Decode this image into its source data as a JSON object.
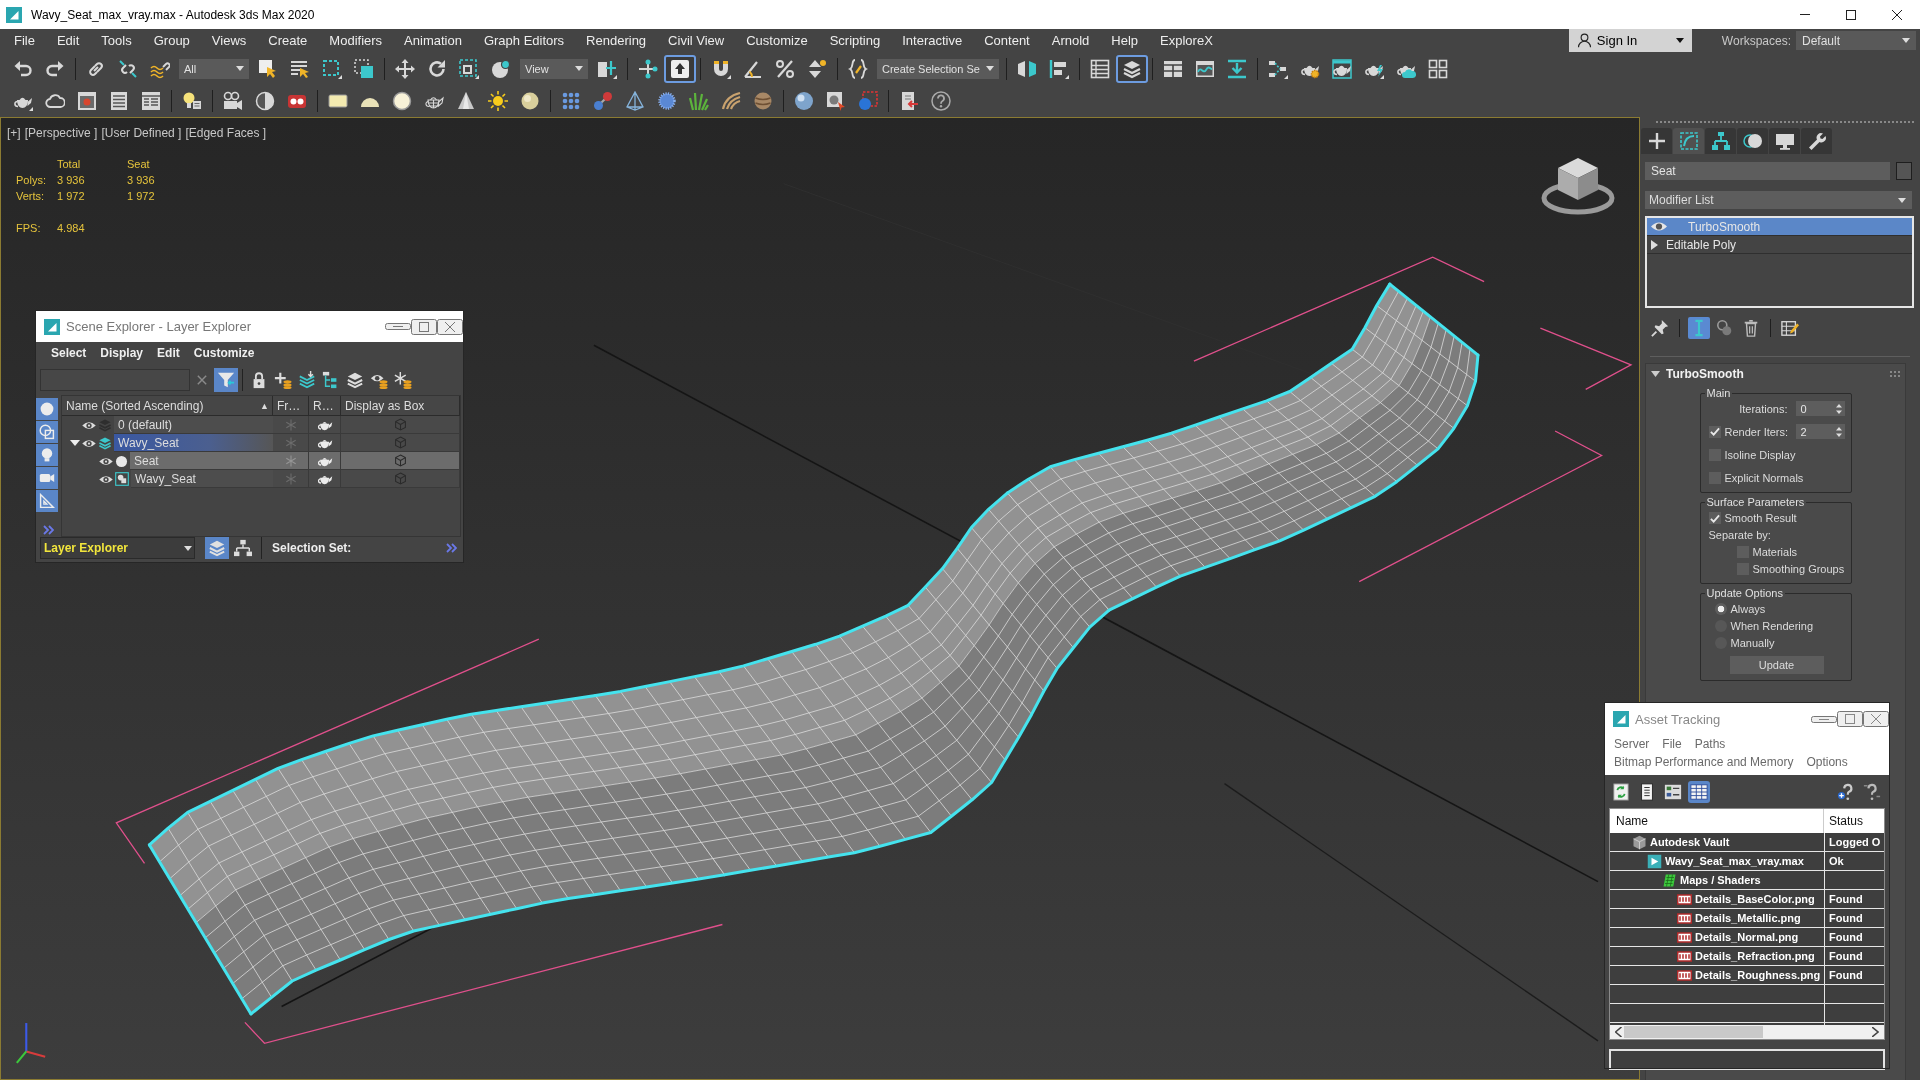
{
  "window": {
    "title": "Wavy_Seat_max_vray.max - Autodesk 3ds Max 2020"
  },
  "menu_bar": {
    "items": [
      "File",
      "Edit",
      "Tools",
      "Group",
      "Views",
      "Create",
      "Modifiers",
      "Animation",
      "Graph Editors",
      "Rendering",
      "Civil View",
      "Customize",
      "Scripting",
      "Interactive",
      "Content",
      "Arnold",
      "Help",
      "ExploreX"
    ],
    "sign_in": "Sign In",
    "workspaces_label": "Workspaces:",
    "workspace": "Default"
  },
  "main_toolbar": {
    "groups": [
      [
        {
          "kind": "button",
          "selected": false
        },
        {
          "kind": "button",
          "selected": false
        }
      ],
      [
        {
          "kind": "button",
          "selected": false
        },
        {
          "kind": "button",
          "selected": false
        },
        {
          "kind": "button",
          "selected": false
        },
        {
          "kind": "dropdown",
          "value": "All"
        },
        {
          "kind": "button",
          "selected": false
        },
        {
          "kind": "button",
          "selected": false
        },
        {
          "kind": "button",
          "selected": false
        },
        {
          "kind": "button",
          "selected": false
        }
      ],
      [
        {
          "kind": "button",
          "selected": false
        },
        {
          "kind": "button",
          "selected": false
        },
        {
          "kind": "button",
          "selected": false
        },
        {
          "kind": "button",
          "selected": false
        },
        {
          "kind": "dropdown",
          "value": "View"
        },
        {
          "kind": "button",
          "selected": false
        }
      ],
      [
        {
          "kind": "button",
          "selected": false
        },
        {
          "kind": "button",
          "selected": true
        }
      ],
      [
        {
          "kind": "button",
          "selected": false
        },
        {
          "kind": "button",
          "selected": false
        },
        {
          "kind": "button",
          "selected": false
        },
        {
          "kind": "button",
          "selected": false
        }
      ],
      [
        {
          "kind": "button",
          "selected": false
        },
        {
          "kind": "dropdown",
          "value": "Create Selection Se"
        }
      ],
      [
        {
          "kind": "button",
          "selected": false
        },
        {
          "kind": "button",
          "selected": false
        }
      ],
      [
        {
          "kind": "button",
          "selected": false
        },
        {
          "kind": "button",
          "selected": true
        }
      ],
      [
        {
          "kind": "button",
          "selected": false
        },
        {
          "kind": "button",
          "selected": false
        },
        {
          "kind": "button",
          "selected": false
        }
      ],
      [
        {
          "kind": "button",
          "selected": false
        },
        {
          "kind": "button",
          "selected": false
        },
        {
          "kind": "button",
          "selected": false
        },
        {
          "kind": "button",
          "selected": false
        },
        {
          "kind": "button",
          "selected": false
        },
        {
          "kind": "button",
          "selected": false
        }
      ]
    ]
  },
  "viewport": {
    "labels": [
      "[+]",
      "[Perspective ]",
      "[User Defined ]",
      "[Edged Faces ]"
    ],
    "stats": {
      "columns": [
        "Total",
        "Seat"
      ],
      "rows": [
        {
          "label": "Polys:",
          "values": [
            "3 936",
            "3 936"
          ]
        },
        {
          "label": "Verts:",
          "values": [
            "1 972",
            "1 972"
          ]
        }
      ],
      "fps": {
        "label": "FPS:",
        "value": "4.984"
      }
    }
  },
  "scene_explorer": {
    "title": "Scene Explorer - Layer Explorer",
    "menu": [
      "Select",
      "Display",
      "Edit",
      "Customize"
    ],
    "tools": [
      {
        "selected": false
      },
      {
        "selected": true
      },
      {
        "selected": false
      },
      {
        "selected": false
      },
      {
        "selected": false
      },
      {
        "selected": false
      },
      {
        "selected": false
      },
      {
        "selected": false
      },
      {
        "selected": false
      }
    ],
    "filters": [
      {
        "selected": true
      },
      {
        "selected": true
      },
      {
        "selected": true
      },
      {
        "selected": true
      },
      {
        "selected": true
      }
    ],
    "columns": [
      {
        "label": "Name (Sorted Ascending)",
        "sort": "▲"
      },
      {
        "label": "Fr…"
      },
      {
        "label": "R…"
      },
      {
        "label": "Display as Box"
      }
    ],
    "tree": [
      {
        "name": "0 (default)",
        "kind": "layer",
        "current": false,
        "selected": false,
        "highlighted": false
      },
      {
        "name": "Wavy_Seat",
        "kind": "layer",
        "current": true,
        "selected": true,
        "highlighted": false,
        "expanded": true,
        "children": [
          {
            "name": "Seat",
            "kind": "object",
            "selected": false,
            "highlighted": true
          },
          {
            "name": "Wavy_Seat",
            "kind": "group",
            "selected": false,
            "highlighted": false
          }
        ]
      }
    ],
    "explorer": "Layer Explorer",
    "modes": [
      {
        "selected": true
      },
      {
        "selected": false
      }
    ],
    "selection_set_label": "Selection Set:"
  },
  "command_panel": {
    "tabs": [
      {
        "selected": false
      },
      {
        "selected": true
      },
      {
        "selected": false
      },
      {
        "selected": false
      },
      {
        "selected": false
      },
      {
        "selected": false
      }
    ],
    "object_name": "Seat",
    "modifier_list": "Modifier List",
    "stack": [
      {
        "name": "TurboSmooth",
        "kind": "modifier",
        "selected": true
      },
      {
        "name": "Editable Poly",
        "kind": "base",
        "selected": false
      }
    ],
    "stack_tools": [
      {
        "selected": false
      },
      {
        "selected": true
      },
      {
        "selected": false
      },
      {
        "selected": false
      },
      {
        "selected": false
      }
    ],
    "rollout": {
      "title": "TurboSmooth",
      "expanded": true,
      "groups": [
        {
          "title": "Main",
          "controls": [
            {
              "kind": "spinner",
              "label": "Iterations:",
              "value": "0"
            },
            {
              "kind": "check_spinner",
              "label": "Render Iters:",
              "checked": true,
              "value": "2"
            },
            {
              "kind": "checkbox",
              "label": "Isoline Display",
              "checked": false
            },
            {
              "kind": "checkbox",
              "label": "Explicit Normals",
              "checked": false
            }
          ]
        },
        {
          "title": "Surface Parameters",
          "controls": [
            {
              "kind": "checkbox",
              "label": "Smooth Result",
              "checked": true
            },
            {
              "kind": "label",
              "label": "Separate by:",
              "children": [
                {
                  "kind": "checkbox",
                  "label": "Materials",
                  "checked": false
                },
                {
                  "kind": "checkbox",
                  "label": "Smoothing Groups",
                  "checked": false
                }
              ]
            }
          ]
        },
        {
          "title": "Update Options",
          "controls": [
            {
              "kind": "radio",
              "label": "Always",
              "selected": true
            },
            {
              "kind": "radio",
              "label": "When Rendering",
              "selected": false
            },
            {
              "kind": "radio",
              "label": "Manually",
              "selected": false
            },
            {
              "kind": "button",
              "label": "Update"
            }
          ]
        }
      ]
    }
  },
  "asset_tracking": {
    "title": "Asset Tracking",
    "menu": [
      "Server",
      "File",
      "Paths",
      "Bitmap Performance and Memory",
      "Options"
    ],
    "tools": [
      {
        "selected": false
      },
      {
        "selected": false
      },
      {
        "selected": false
      },
      {
        "selected": true
      },
      {
        "selected": false
      },
      {
        "selected": false
      }
    ],
    "columns": [
      "Name",
      "Status"
    ],
    "rows": [
      {
        "name": "Autodesk Vault",
        "kind": "vault",
        "status": "Logged O",
        "children": [
          {
            "name": "Wavy_Seat_max_vray.max",
            "kind": "scene",
            "status": "Ok",
            "children": [
              {
                "name": "Maps / Shaders",
                "kind": "folder",
                "children": [
                  {
                    "name": "Details_BaseColor.png",
                    "kind": "image",
                    "status": "Found"
                  },
                  {
                    "name": "Details_Metallic.png",
                    "kind": "image",
                    "status": "Found"
                  },
                  {
                    "name": "Details_Normal.png",
                    "kind": "image",
                    "status": "Found"
                  },
                  {
                    "name": "Details_Refraction.png",
                    "kind": "image",
                    "status": "Found"
                  },
                  {
                    "name": "Details_Roughness.png",
                    "kind": "image",
                    "status": "Found"
                  }
                ]
              }
            ]
          }
        ]
      }
    ]
  }
}
